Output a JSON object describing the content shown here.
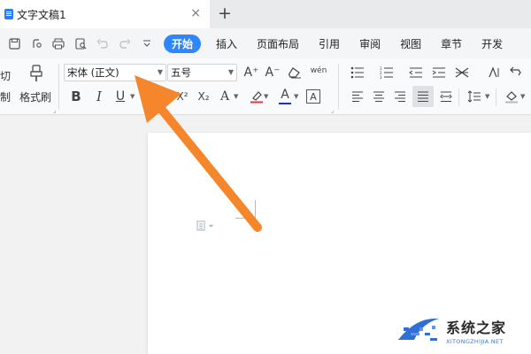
{
  "window": {
    "tab_title": "文字文稿1",
    "close_glyph": "×",
    "add_glyph": "+"
  },
  "quick_access": [
    "save-icon",
    "print-preview-icon",
    "print-icon",
    "find-icon",
    "undo-icon",
    "redo-icon",
    "more-icon"
  ],
  "menu": {
    "tabs": [
      "开始",
      "插入",
      "页面布局",
      "引用",
      "审阅",
      "视图",
      "章节",
      "开发"
    ],
    "active": "开始"
  },
  "ribbon": {
    "cut_label": "切",
    "copy_label": "制",
    "format_painter_label": "格式刷",
    "font_name": "宋体 (正文)",
    "font_size": "五号",
    "bold": "B",
    "italic": "I",
    "underline": "U",
    "superscript": "X²",
    "subscript": "X₂",
    "text_effect": "A",
    "font_color": "A",
    "char_border": "A",
    "grow_font": "A⁺",
    "shrink_font": "A⁻",
    "phonetic": "wén"
  },
  "watermark": {
    "title": "系统之家",
    "url": "XITONGZHIJIA.NET"
  },
  "colors": {
    "accent": "#2e87ff",
    "arrow": "#f5862b",
    "font_color_bar": "#1f2fcf",
    "highlight_bar": "#e23b3b"
  }
}
